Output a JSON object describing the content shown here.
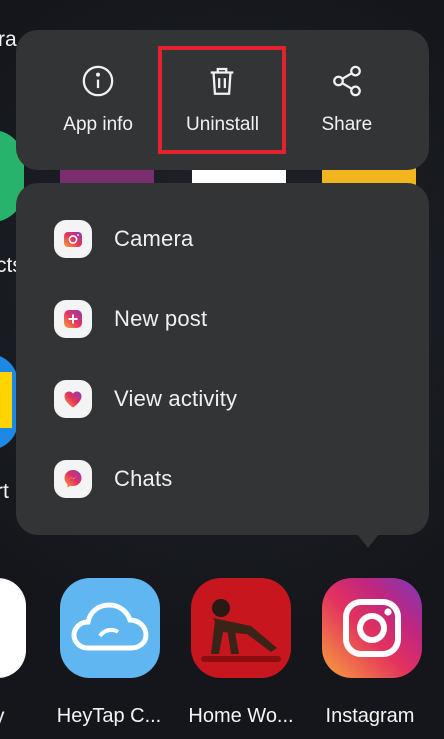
{
  "background": {
    "labels": [
      "ra",
      "cts",
      "rt",
      "y"
    ]
  },
  "actions": [
    {
      "label": "App info",
      "icon": "info-icon"
    },
    {
      "label": "Uninstall",
      "icon": "trash-icon"
    },
    {
      "label": "Share",
      "icon": "share-icon"
    }
  ],
  "menu": [
    {
      "label": "Camera",
      "icon": "camera-icon"
    },
    {
      "label": "New post",
      "icon": "new-post-icon"
    },
    {
      "label": "View activity",
      "icon": "heart-icon"
    },
    {
      "label": "Chats",
      "icon": "messenger-icon"
    }
  ],
  "dock": [
    {
      "label": "HeyTap C...",
      "icon": "heytap-cloud-icon"
    },
    {
      "label": "Home Wo...",
      "icon": "home-workout-icon"
    },
    {
      "label": "Instagram",
      "icon": "instagram-icon"
    }
  ],
  "colors": {
    "highlight": "#e2222d",
    "card": "#333436"
  }
}
